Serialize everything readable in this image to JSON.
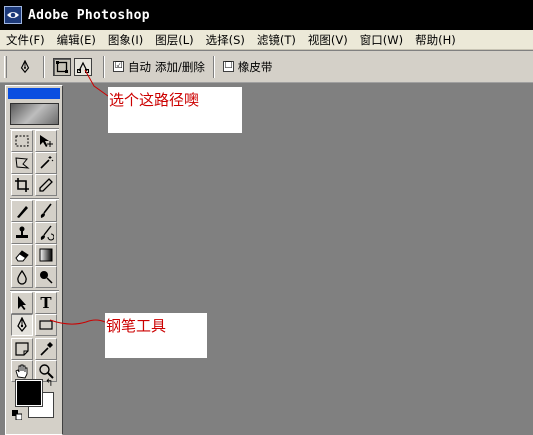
{
  "window": {
    "title": "Adobe Photoshop",
    "icon": "photoshop-eye-icon"
  },
  "menu": [
    "文件(F)",
    "编辑(E)",
    "图象(I)",
    "图层(L)",
    "选择(S)",
    "滤镜(T)",
    "视图(V)",
    "窗口(W)",
    "帮助(H)"
  ],
  "options": {
    "auto_label": "自动",
    "add_delete_label": "添加/删除",
    "rubber_band_label": "橡皮带",
    "auto_checked": true,
    "rubber_band_checked": false,
    "auto_mark": "☑",
    "rubber_band_mark": "☐"
  },
  "tools": {
    "type_tool_label": "T",
    "swap_glyph": "↰"
  },
  "annotations": {
    "path_hint": "选个这路径噢",
    "pen_hint": "钢笔工具"
  },
  "colors": {
    "canvas": "#808080",
    "annotation_text": "#cc0000",
    "foreground": "#000000",
    "background": "#ffffff",
    "toolbox_header": "#0a4ee0"
  }
}
